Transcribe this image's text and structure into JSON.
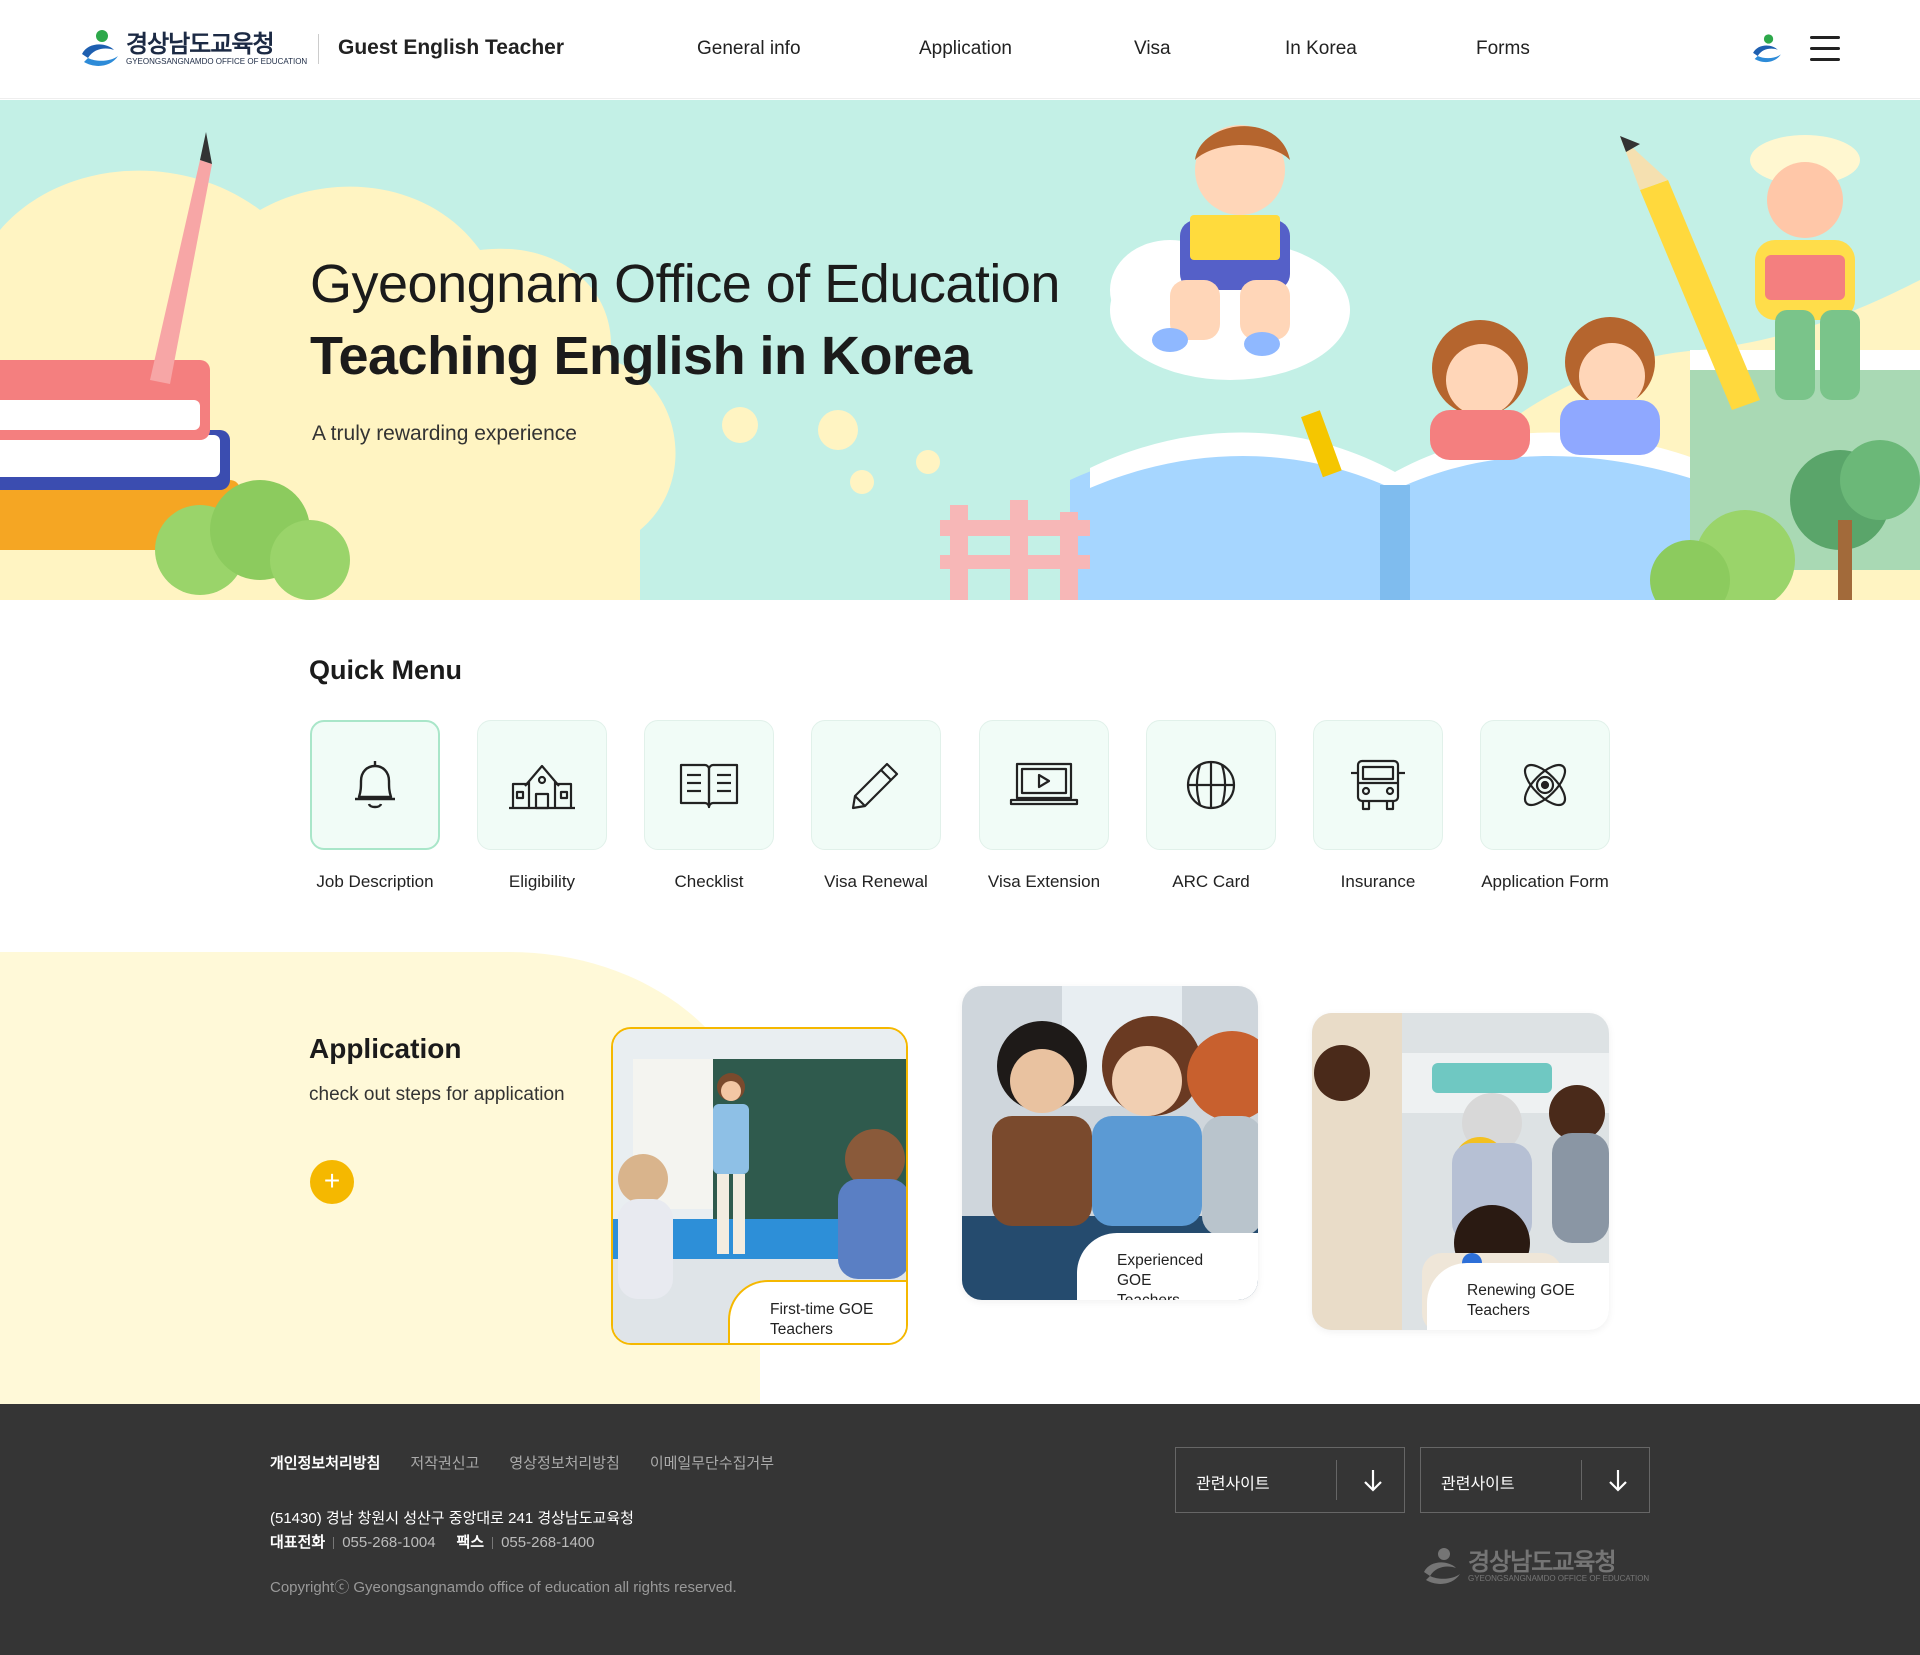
{
  "header": {
    "logo_ko": "경상남도교육청",
    "logo_en": "GYEONGSANGNAMDO OFFICE OF EDUCATION",
    "site_name": "Guest English Teacher",
    "nav": [
      "General info",
      "Application",
      "Visa",
      "In Korea",
      "Forms"
    ]
  },
  "hero": {
    "title_line1": "Gyeongnam Office of Education",
    "title_line2": "Teaching English in Korea",
    "subtitle": "A truly rewarding experience"
  },
  "quick_menu": {
    "title": "Quick Menu",
    "items": [
      {
        "label": "Job Description",
        "icon": "bell-icon"
      },
      {
        "label": "Eligibility",
        "icon": "school-icon"
      },
      {
        "label": "Checklist",
        "icon": "book-icon"
      },
      {
        "label": "Visa Renewal",
        "icon": "pencil-icon"
      },
      {
        "label": "Visa Extension",
        "icon": "laptop-icon"
      },
      {
        "label": "ARC Card",
        "icon": "globe-icon"
      },
      {
        "label": "Insurance",
        "icon": "bus-icon"
      },
      {
        "label": "Application Form",
        "icon": "atom-icon"
      }
    ]
  },
  "application": {
    "title": "Application",
    "subtitle": "check out steps for application",
    "plus": "+",
    "cards": [
      {
        "line1": "First-time GOE",
        "line2": "Teachers"
      },
      {
        "line1": "Experienced GOE",
        "line2": "Teachers"
      },
      {
        "line1": "Renewing GOE",
        "line2": "Teachers"
      }
    ]
  },
  "footer": {
    "links": [
      "개인정보처리방침",
      "저작권신고",
      "영상정보처리방침",
      "이메일무단수집거부"
    ],
    "address": "(51430) 경남 창원시 성산구 중앙대로 241 경상남도교육청",
    "tel_label": "대표전화",
    "tel": "055-268-1004",
    "fax_label": "팩스",
    "fax": "055-268-1400",
    "copyright": "Copyrightⓒ Gyeongsangnamdo office of education all rights reserved.",
    "selects": [
      "관련사이트",
      "관련사이트"
    ],
    "logo_ko": "경상남도교육청",
    "logo_en": "GYEONGSANGNAMDO OFFICE OF EDUCATION"
  },
  "colors": {
    "hero_bg": "#c3f0e6",
    "accent_yellow": "#f5b800",
    "quick_bg": "#f1fcf7",
    "footer_bg": "#353535"
  }
}
